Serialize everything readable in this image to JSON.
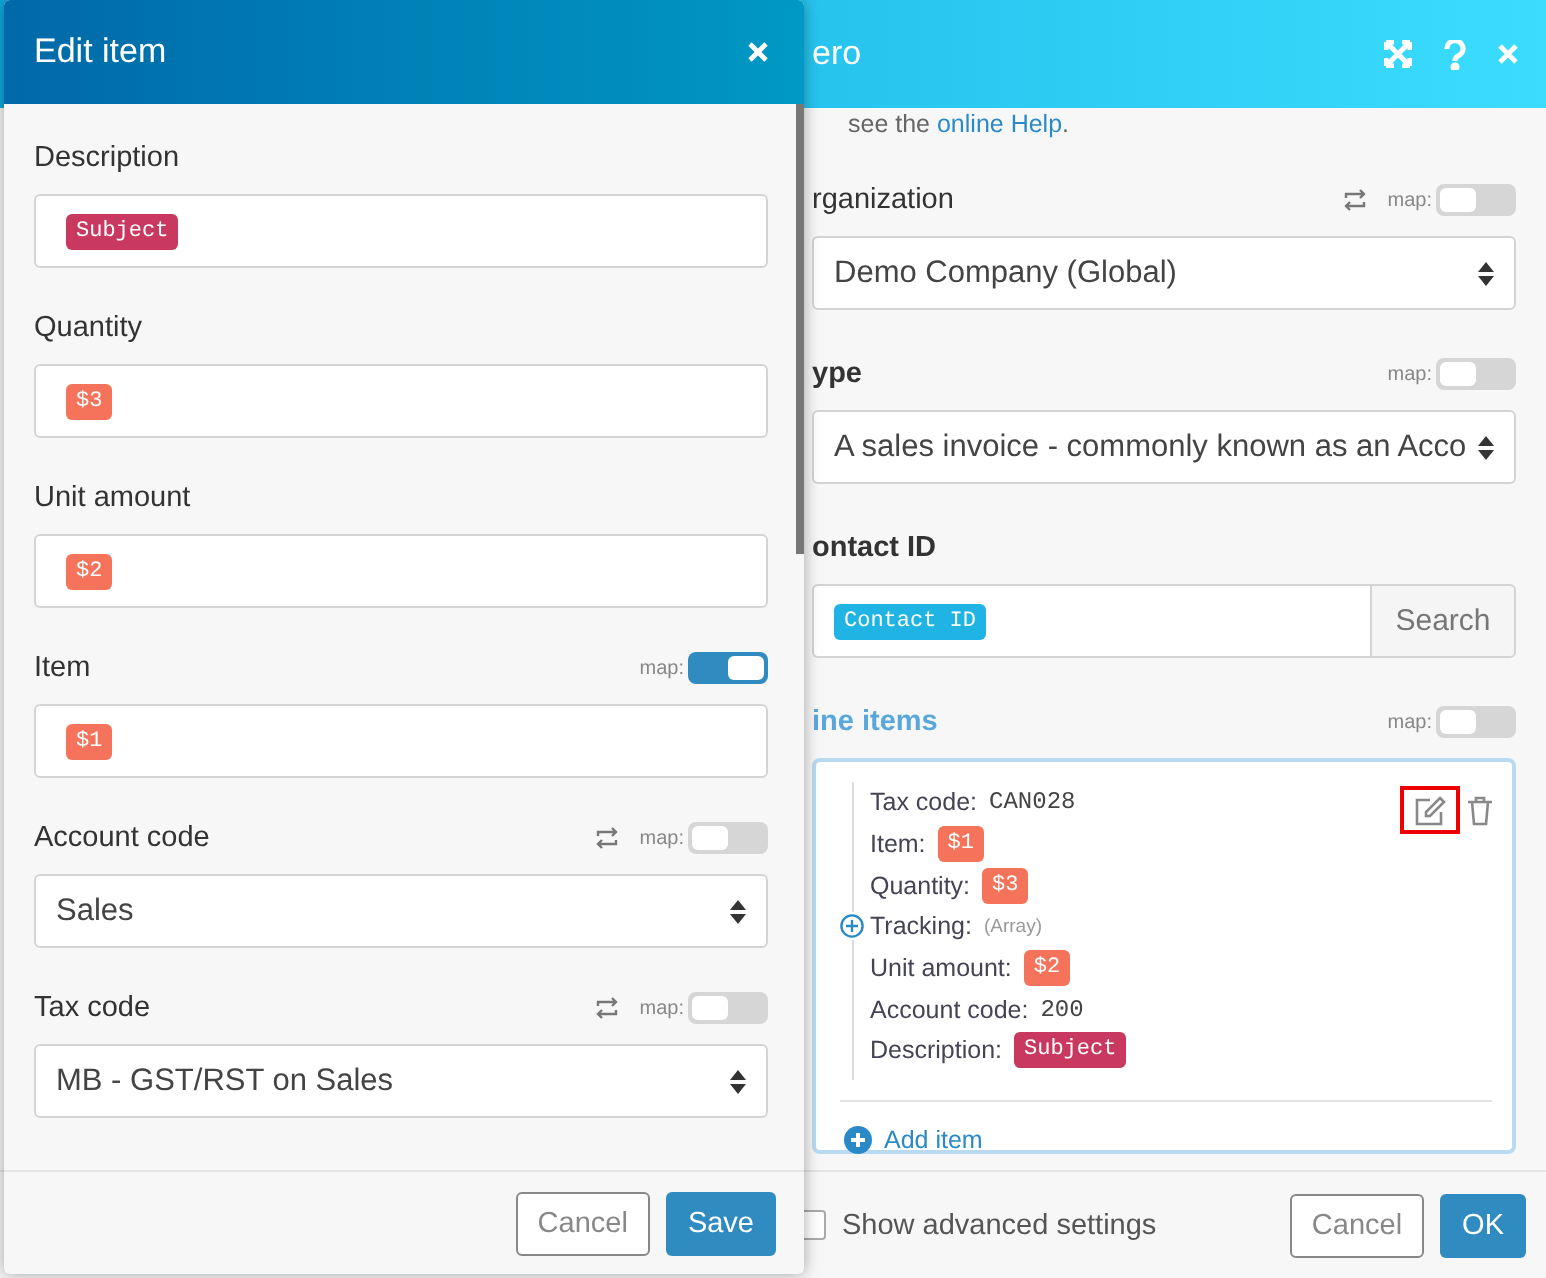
{
  "module": {
    "title": "ero",
    "help": {
      "text": "see the ",
      "link": "online Help",
      "after": "."
    },
    "fields": [
      {
        "kind": "select",
        "label": "rganization",
        "bold": false,
        "swap": true,
        "map_label": "map:",
        "map": false,
        "value": "Demo Company (Global)"
      },
      {
        "kind": "select",
        "label": "ype",
        "bold": true,
        "swap": false,
        "map_label": "map:",
        "map": false,
        "value": "A sales invoice - commonly known as an Acco"
      },
      {
        "kind": "search",
        "label": "ontact ID",
        "bold": true,
        "swap": false,
        "pill": {
          "text": "Contact ID",
          "color": "#1fb4e3"
        },
        "button": "Search"
      },
      {
        "kind": "list",
        "label": "ine items",
        "bold": true,
        "swap": false,
        "map_label": "map:",
        "map": false,
        "rows": [
          {
            "kind": "plain",
            "label": "Tax code:",
            "value": "CAN028"
          },
          {
            "kind": "pill",
            "label": "Item:",
            "value": "$1",
            "color": "#f5735a"
          },
          {
            "kind": "pill",
            "label": "Quantity:",
            "value": "$3",
            "color": "#f5735a"
          },
          {
            "kind": "array",
            "label": "Tracking:",
            "value": "(Array)",
            "expanded": false
          },
          {
            "kind": "pill",
            "label": "Unit amount:",
            "value": "$2",
            "color": "#f5735a"
          },
          {
            "kind": "plain",
            "label": "Account code:",
            "value": "200"
          },
          {
            "kind": "pill",
            "label": "Description:",
            "value": "Subject",
            "color": "#c8385f"
          }
        ],
        "edit_highlighted": true,
        "add": "Add item"
      }
    ],
    "advanced": {
      "label": "Show advanced settings",
      "checked": false
    },
    "buttons": {
      "cancel": "Cancel",
      "ok": "OK"
    }
  },
  "dialog": {
    "title": "Edit item",
    "fields": [
      {
        "kind": "pill",
        "label": "Description",
        "value": "Subject",
        "color": "#c8385f"
      },
      {
        "kind": "pill",
        "label": "Quantity",
        "value": "$3",
        "color": "#f5735a"
      },
      {
        "kind": "pill",
        "label": "Unit amount",
        "value": "$2",
        "color": "#f5735a"
      },
      {
        "kind": "pill",
        "label": "Item",
        "value": "$1",
        "color": "#f5735a",
        "map_label": "map:",
        "map": true
      },
      {
        "kind": "select",
        "label": "Account code",
        "value": "Sales",
        "swap": true,
        "map_label": "map:",
        "map": false
      },
      {
        "kind": "select",
        "label": "Tax code",
        "value": "MB - GST/RST on Sales",
        "swap": true,
        "map_label": "map:",
        "map": false
      }
    ],
    "buttons": {
      "cancel": "Cancel",
      "save": "Save"
    }
  }
}
